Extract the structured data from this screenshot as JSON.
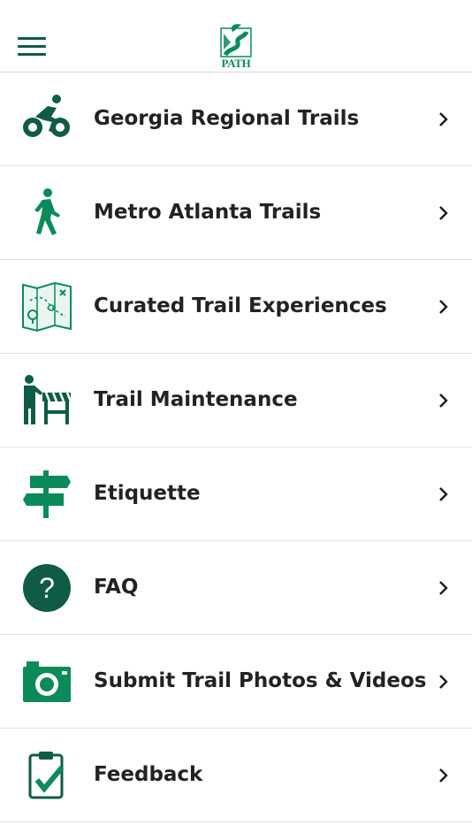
{
  "header": {
    "logo_text": "PATH"
  },
  "colors": {
    "accent": "#0b8a5a",
    "dark_green": "#0f5b45",
    "text": "#222222",
    "divider": "#e1e1e1"
  },
  "menu": [
    {
      "label": "Georgia Regional Trails",
      "icon": "cyclist-icon"
    },
    {
      "label": "Metro Atlanta Trails",
      "icon": "walker-icon"
    },
    {
      "label": "Curated Trail Experiences",
      "icon": "map-icon"
    },
    {
      "label": "Trail Maintenance",
      "icon": "maintenance-worker-icon"
    },
    {
      "label": "Etiquette",
      "icon": "signpost-icon"
    },
    {
      "label": "FAQ",
      "icon": "question-icon"
    },
    {
      "label": "Submit Trail Photos & Videos",
      "icon": "camera-icon"
    },
    {
      "label": "Feedback",
      "icon": "clipboard-check-icon"
    }
  ]
}
